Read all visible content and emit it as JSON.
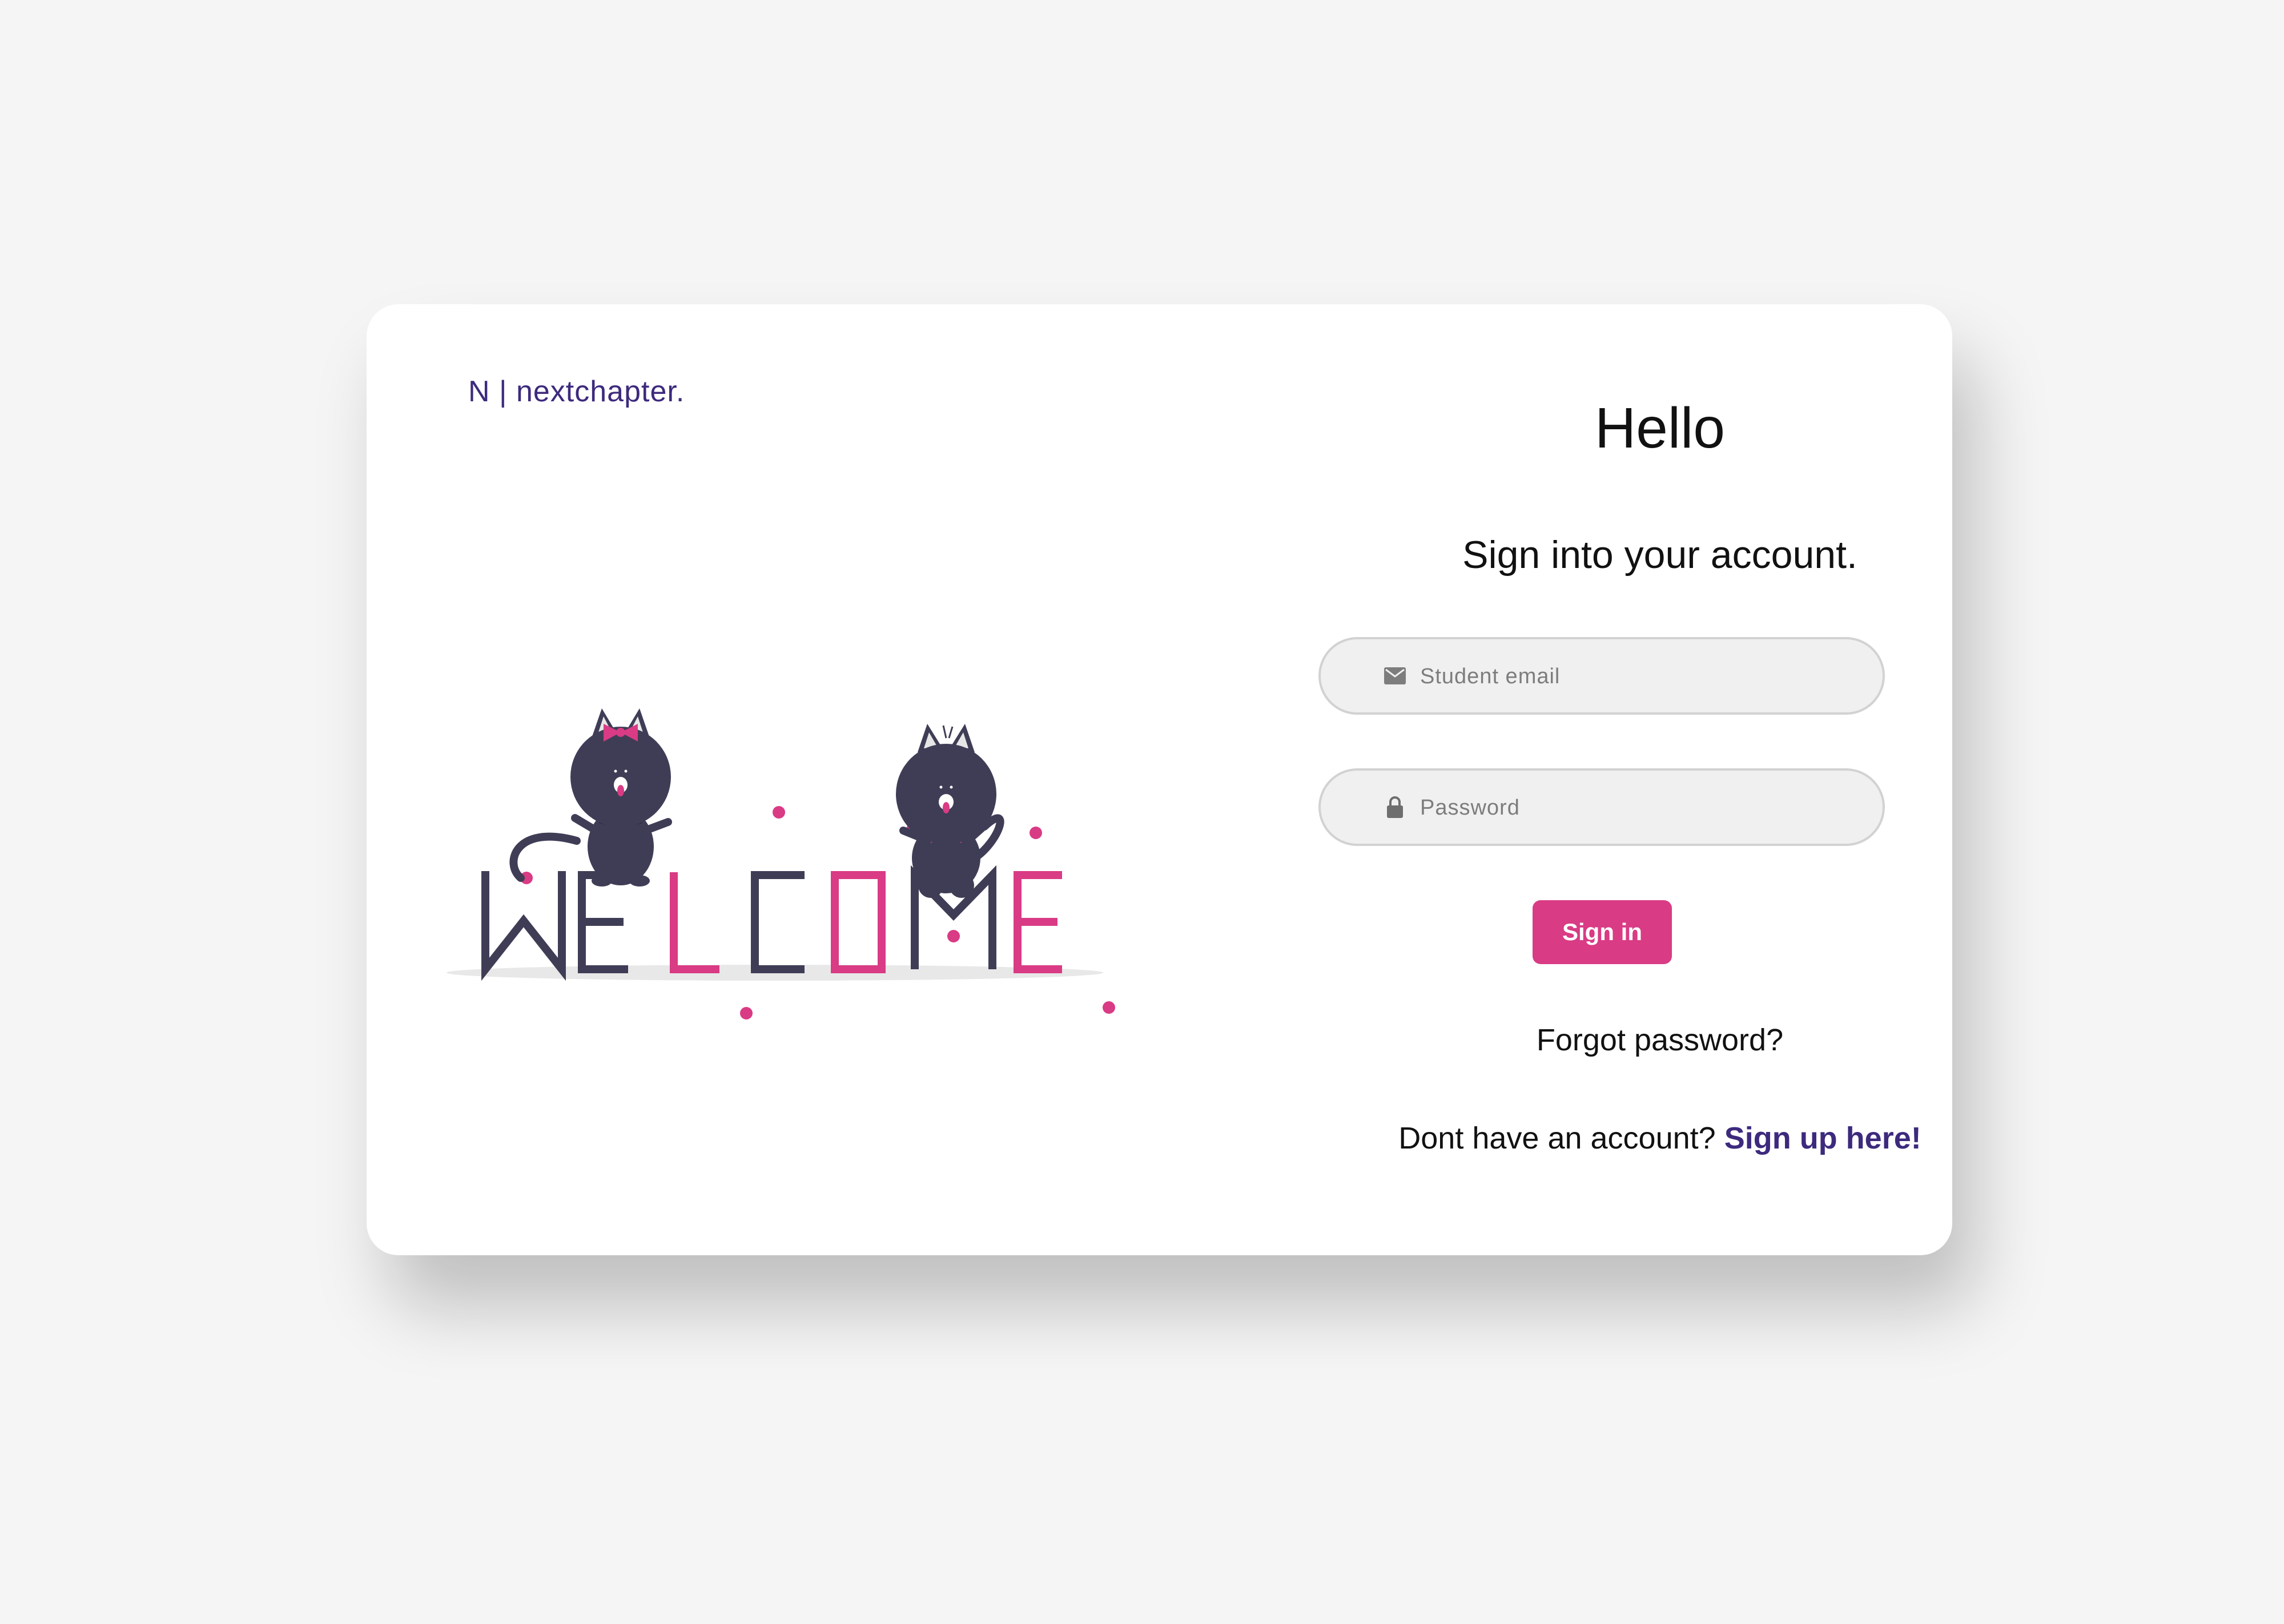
{
  "brand": {
    "text": "N | nextchapter."
  },
  "colors": {
    "brand_purple": "#3d2a7d",
    "accent_pink": "#d93b85",
    "cat_dark": "#3f3d56",
    "background": "#f5f5f5",
    "card": "#ffffff"
  },
  "illustration": {
    "welcome_letters": [
      "W",
      "E",
      "L",
      "C",
      "O",
      "M",
      "E"
    ]
  },
  "form": {
    "title": "Hello",
    "subtitle": "Sign into your account.",
    "email": {
      "placeholder": "Student email",
      "value": "",
      "icon": "mail-icon"
    },
    "password": {
      "placeholder": "Password",
      "value": "",
      "icon": "lock-icon"
    },
    "submit_label": "Sign in",
    "forgot_label": "Forgot password?",
    "signup_prompt": "Dont have an account?",
    "signup_link": "Sign up here!"
  }
}
